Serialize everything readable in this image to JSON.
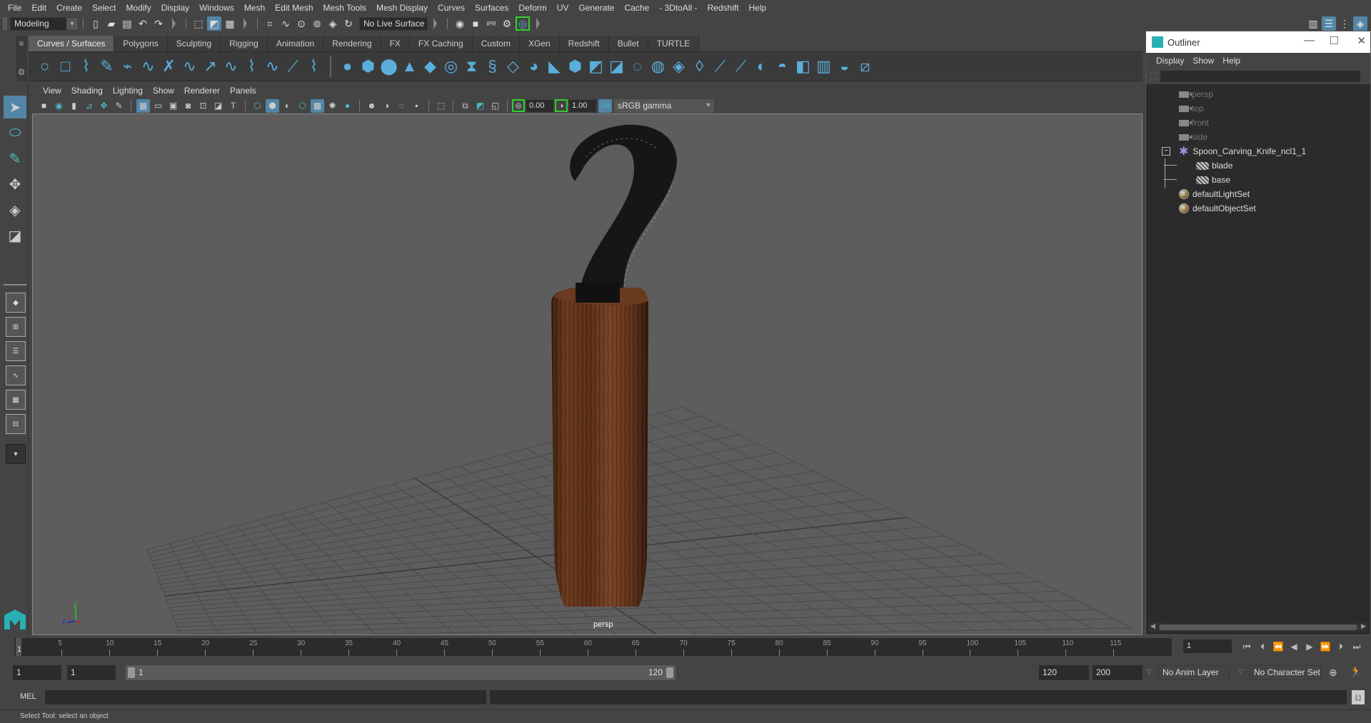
{
  "menubar": [
    "File",
    "Edit",
    "Create",
    "Select",
    "Modify",
    "Display",
    "Windows",
    "Mesh",
    "Edit Mesh",
    "Mesh Tools",
    "Mesh Display",
    "Curves",
    "Surfaces",
    "Deform",
    "UV",
    "Generate",
    "Cache",
    "- 3DtoAll -",
    "Redshift",
    "Help"
  ],
  "statusline": {
    "menuset": "Modeling",
    "live_surface": "No Live Surface",
    "icons": [
      "new-scene-icon",
      "open-scene-icon",
      "save-scene-icon",
      "undo-icon",
      "redo-icon",
      "select-hierarchy-icon",
      "select-object-icon",
      "select-component-icon",
      "snap-grid-icon",
      "snap-curve-icon",
      "snap-point-icon",
      "snap-view-plane-icon",
      "make-live-icon",
      "snap-together-icon",
      "render-view-icon",
      "render-current-icon",
      "ipr-render-icon",
      "render-settings-icon",
      "hypershade-icon"
    ],
    "right_icons": [
      "modeling-toolkit-icon",
      "attribute-editor-icon",
      "tool-settings-icon",
      "channel-box-icon"
    ]
  },
  "shelf": {
    "tabs": [
      "Curves / Surfaces",
      "Polygons",
      "Sculpting",
      "Rigging",
      "Animation",
      "Rendering",
      "FX",
      "FX Caching",
      "Custom",
      "XGen",
      "Redshift",
      "Bullet",
      "TURTLE"
    ],
    "active_tab": "Curves / Surfaces",
    "curve_icons": [
      "nurbs-circle-icon",
      "nurbs-square-icon",
      "cv-curve-icon",
      "pencil-curve-icon",
      "ep-curve-icon",
      "bezier-curve-icon",
      "curve-cut-icon",
      "attach-curve-icon",
      "extend-curve-icon",
      "rebuild-curve-icon",
      "offset-curve-icon",
      "reverse-curve-icon",
      "curve-fillet-icon",
      "insert-knot-icon"
    ],
    "surface_icons": [
      "nurbs-sphere-icon",
      "nurbs-cube-icon",
      "nurbs-cylinder-icon",
      "nurbs-cone-icon",
      "nurbs-plane-icon",
      "nurbs-torus-icon",
      "revolve-icon",
      "loft-icon",
      "planar-icon",
      "extrude-icon",
      "birail-icon",
      "surface-cube-icon",
      "boundary-icon",
      "square-surface-icon",
      "bevel-icon",
      "bevel-plus-icon",
      "intersect-icon",
      "project-curve-icon",
      "trim-icon",
      "untrim-icon",
      "attach-surface-icon",
      "detach-surface-icon",
      "align-surface-icon",
      "rebuild-surface-icon",
      "sculpt-surface-icon",
      "open-close-surface-icon"
    ]
  },
  "toolbox": [
    "select-tool-icon",
    "lasso-tool-icon",
    "paint-select-tool-icon",
    "move-tool-icon",
    "rotate-tool-icon",
    "scale-tool-icon"
  ],
  "layouts": [
    "single-perspective-layout-icon",
    "four-view-layout-icon",
    "persp-outliner-layout-icon",
    "persp-graph-layout-icon",
    "hypershade-persp-layout-icon",
    "persp-graph-hypergraph-layout-icon"
  ],
  "panel": {
    "menu": [
      "View",
      "Shading",
      "Lighting",
      "Show",
      "Renderer",
      "Panels"
    ],
    "exposure": "0.00",
    "gamma": "1.00",
    "color_space": "sRGB gamma",
    "camera_label": "persp"
  },
  "outliner": {
    "title": "Outliner",
    "menu": [
      "Display",
      "Show",
      "Help"
    ],
    "items": [
      {
        "label": "persp",
        "type": "camera",
        "dim": true,
        "indent": 0
      },
      {
        "label": "top",
        "type": "camera",
        "dim": true,
        "indent": 0
      },
      {
        "label": "front",
        "type": "camera",
        "dim": true,
        "indent": 0
      },
      {
        "label": "side",
        "type": "camera",
        "dim": true,
        "indent": 0
      },
      {
        "label": "Spoon_Carving_Knife_ncl1_1",
        "type": "group",
        "dim": false,
        "indent": 0,
        "expanded": true
      },
      {
        "label": "blade",
        "type": "mesh",
        "dim": false,
        "indent": 1
      },
      {
        "label": "base",
        "type": "mesh",
        "dim": false,
        "indent": 1
      },
      {
        "label": "defaultLightSet",
        "type": "set",
        "dim": false,
        "indent": 0
      },
      {
        "label": "defaultObjectSet",
        "type": "set",
        "dim": false,
        "indent": 0
      }
    ]
  },
  "timeslider": {
    "start": 1,
    "end": 120,
    "ticks": [
      5,
      10,
      15,
      20,
      25,
      30,
      35,
      40,
      45,
      50,
      55,
      60,
      65,
      70,
      75,
      80,
      85,
      90,
      95,
      100,
      105,
      110,
      115
    ],
    "current_frame": "1",
    "current_marker": "1",
    "playback_icons": [
      "go-to-start-icon",
      "step-back-frame-icon",
      "step-back-key-icon",
      "play-backwards-icon",
      "play-forwards-icon",
      "step-forward-key-icon",
      "step-forward-frame-icon",
      "go-to-end-icon"
    ]
  },
  "rangeslider": {
    "start_field": "1",
    "playback_start_field": "1",
    "range_start": "1",
    "range_end": "120",
    "playback_end_field": "120",
    "end_field": "200",
    "anim_layer": "No Anim Layer",
    "character_set": "No Character Set"
  },
  "cmdline": {
    "label": "MEL"
  },
  "helpline": {
    "text": "Select Tool: select an object"
  }
}
